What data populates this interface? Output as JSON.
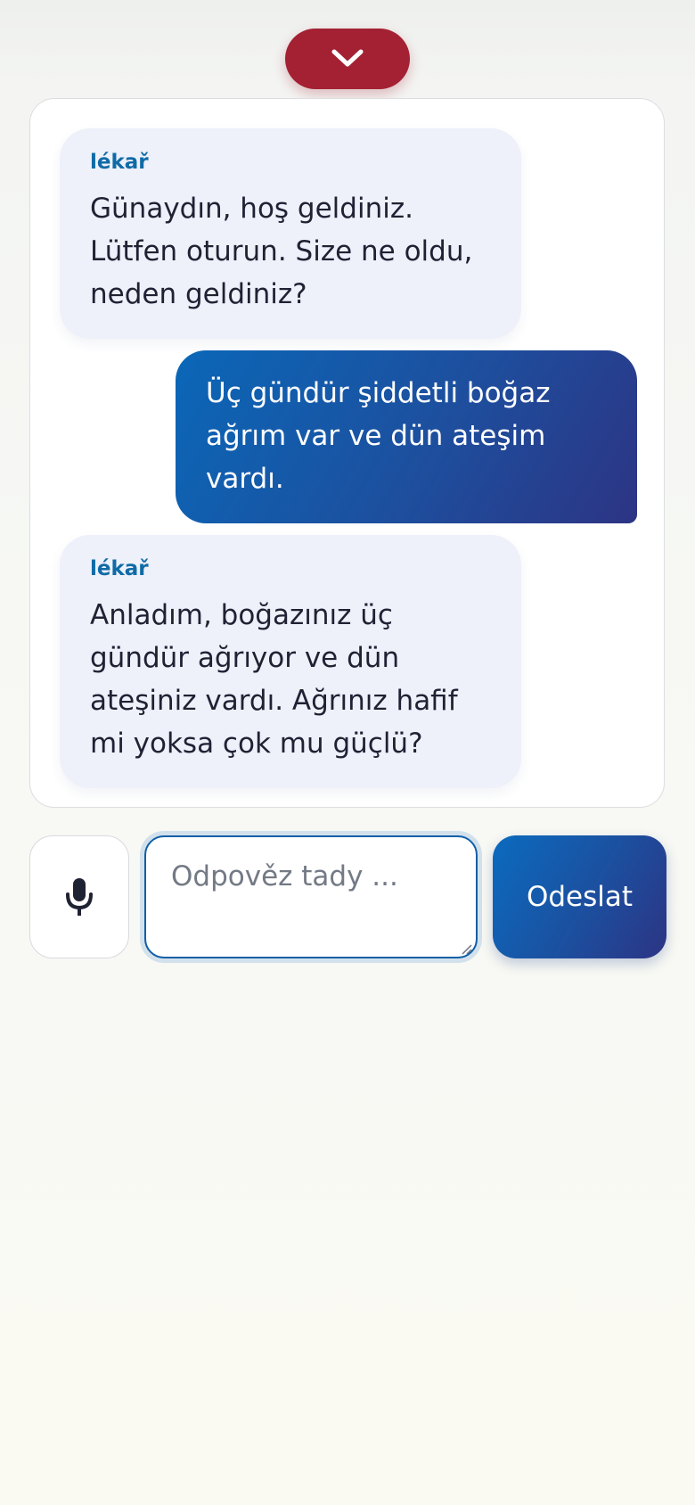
{
  "header": {
    "collapse_icon": "chevron-down-icon",
    "accent_color": "#a32133"
  },
  "chat": {
    "messages": [
      {
        "role": "doctor",
        "sender": "lékař",
        "text": "Günaydın, hoş geldiniz. Lütfen oturun. Size ne oldu, neden geldiniz?"
      },
      {
        "role": "user",
        "text": "Üç gündür şiddetli boğaz ağrım var ve dün ateşim vardı."
      },
      {
        "role": "doctor",
        "sender": "lékař",
        "text": "Anladım, boğazınız üç gündür ağrıyor ve dün ateşiniz vardı. Ağrınız hafif mi yoksa çok mu güçlü?"
      }
    ]
  },
  "composer": {
    "mic_icon": "microphone-icon",
    "placeholder": "Odpověz tady ...",
    "value": "",
    "send_label": "Odeslat"
  },
  "colors": {
    "doctor_bubble": "#eef0fa",
    "user_bubble": "#1d4f9e",
    "sender_label": "#0f6ba6"
  }
}
